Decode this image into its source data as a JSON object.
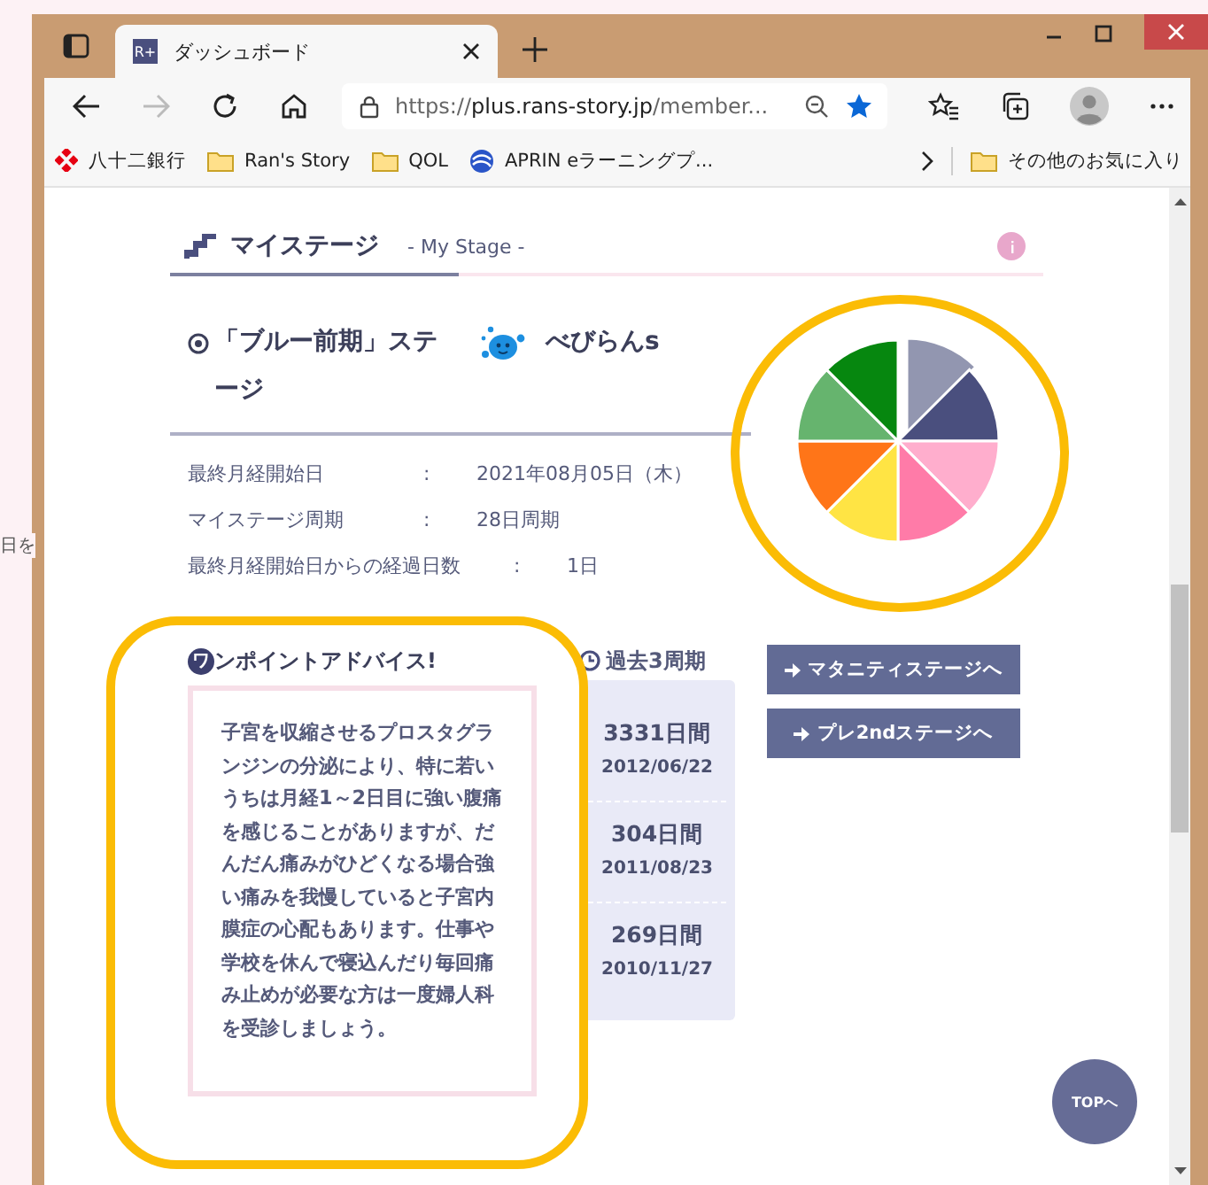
{
  "background_window": {
    "text": "日を"
  },
  "window": {
    "tab_title": "ダッシュボード",
    "tab_icon": "R+",
    "url": {
      "scheme": "https://",
      "host": "plus.rans-story.jp",
      "path": "/member..."
    }
  },
  "bookmarks": [
    {
      "label": "八十二銀行",
      "kind": "bank"
    },
    {
      "label": "Ran's Story",
      "kind": "folder"
    },
    {
      "label": "QOL",
      "kind": "folder"
    },
    {
      "label": "APRIN eラーニングプ...",
      "kind": "globe"
    }
  ],
  "other_bookmarks": "その他のお気に入り",
  "page": {
    "section_title": "マイステージ",
    "section_subtitle": "- My Stage -",
    "stage_title": "「ブルー前期」ステージ",
    "mascot_name": "べびらんs",
    "info_rows": [
      {
        "label": "最終月経開始日",
        "separator": ":",
        "value": "2021年08月05日（木）"
      },
      {
        "label": "マイステージ周期",
        "separator": ":",
        "value": "28日周期"
      },
      {
        "label": "最終月経開始日からの経過日数",
        "separator": ":",
        "value": "1日"
      }
    ],
    "advice": {
      "badge": "ワ",
      "title": "ンポイントアドバイス!",
      "text": "子宮を収縮させるプロスタグランジンの分泌により、特に若いうちは月経1～2日目に強い腹痛を感じることがありますが、だんだん痛みがひどくなる場合強い痛みを我慢していると子宮内膜症の心配もあります。仕事や学校を休んで寝込んだり毎回痛み止めが必要な方は一度婦人科を受診しましょう。"
    },
    "history": {
      "title": "過去3周期",
      "entries": [
        {
          "days": "3331日間",
          "date": "2012/06/22"
        },
        {
          "days": "304日間",
          "date": "2011/08/23"
        },
        {
          "days": "269日間",
          "date": "2010/11/27"
        }
      ]
    },
    "buttons": [
      "マタニティステージへ",
      "プレ2ndステージへ"
    ],
    "top_button": "TOPへ"
  }
}
